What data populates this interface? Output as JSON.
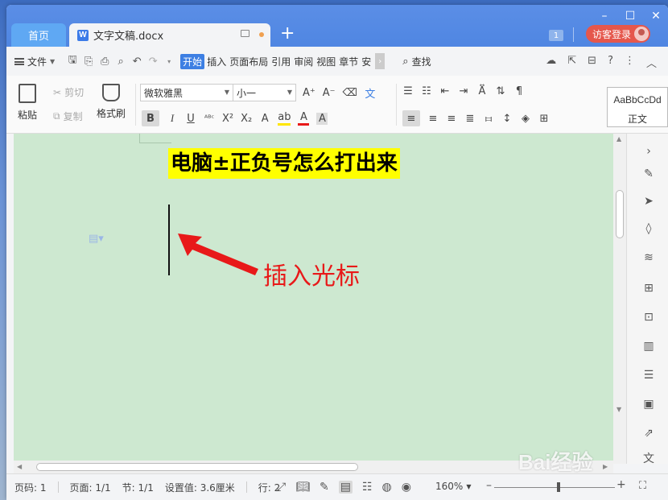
{
  "titlebar": {
    "home_tab": "首页",
    "doc_tab": "文字文稿.docx",
    "add_tab": "+",
    "badge": "1",
    "login": "访客登录",
    "minimize": "–",
    "maximize": "☐",
    "close": "✕"
  },
  "menubar": {
    "file": "文件",
    "tabs": [
      "开始",
      "插入",
      "页面布局",
      "引用",
      "审阅",
      "视图",
      "章节",
      "安"
    ],
    "search": "查找"
  },
  "ribbon": {
    "paste": "粘贴",
    "cut": "剪切",
    "copy": "复制",
    "format_painter": "格式刷",
    "font_name": "微软雅黑",
    "font_size": "小一",
    "style_preview": "AaBbCcDd",
    "style_name": "正文"
  },
  "document": {
    "title": "电脑±正负号怎么打出来",
    "annotation": "插入光标"
  },
  "statusbar": {
    "page_num": "页码: 1",
    "page": "页面: 1/1",
    "section": "节: 1/1",
    "setting": "设置值: 3.6厘米",
    "row": "行: 2",
    "zoom": "160%"
  },
  "watermark": "Bai经验",
  "colors": {
    "titlebar": "#4f86e2",
    "doc_background": "#cde8d0",
    "title_highlight": "#ffff00",
    "annotation": "#e81919",
    "login_button": "#e5574c"
  }
}
